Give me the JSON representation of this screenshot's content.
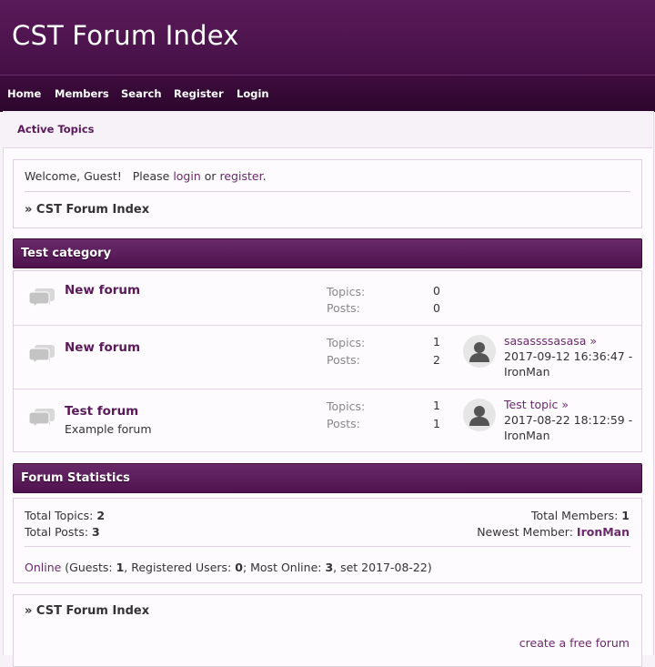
{
  "site": {
    "title": "CST Forum Index"
  },
  "nav": {
    "items": [
      "Home",
      "Members",
      "Search",
      "Register",
      "Login"
    ]
  },
  "subnav": {
    "active_topics": "Active Topics"
  },
  "welcome": {
    "prefix": "Welcome, Guest!   Please ",
    "login": "login",
    "or": " or ",
    "register": "register",
    "suffix": ".",
    "breadcrumb": "» CST Forum Index"
  },
  "category": {
    "title": "Test category",
    "forums": [
      {
        "name": "New forum",
        "description": "",
        "topics_label": "Topics:",
        "topics": "0",
        "posts_label": "Posts:",
        "posts": "0",
        "last_post": null
      },
      {
        "name": "New forum",
        "description": "",
        "topics_label": "Topics:",
        "topics": "1",
        "posts_label": "Posts:",
        "posts": "2",
        "last_post": {
          "title": "sasassssasasa »",
          "datetime": "2017-09-12 16:36:47 -",
          "author": "IronMan"
        }
      },
      {
        "name": "Test forum",
        "description": "Example forum",
        "topics_label": "Topics:",
        "topics": "1",
        "posts_label": "Posts:",
        "posts": "1",
        "last_post": {
          "title": "Test topic »",
          "datetime": "2017-08-22 18:12:59 -",
          "author": "IronMan"
        }
      }
    ]
  },
  "stats": {
    "title": "Forum Statistics",
    "total_topics_label": "Total Topics: ",
    "total_topics": "2",
    "total_posts_label": "Total Posts: ",
    "total_posts": "3",
    "total_members_label": "Total Members: ",
    "total_members": "1",
    "newest_member_label": "Newest Member: ",
    "newest_member": "IronMan",
    "online_link": "Online",
    "guests_label": " (Guests: ",
    "guests": "1",
    "registered_label": ", Registered Users: ",
    "registered": "0",
    "most_online_label": "; Most Online: ",
    "most_online": "3",
    "set_label": ", set 2017-08-22)"
  },
  "footer": {
    "breadcrumb": "» CST Forum Index",
    "link": "create a free forum"
  }
}
